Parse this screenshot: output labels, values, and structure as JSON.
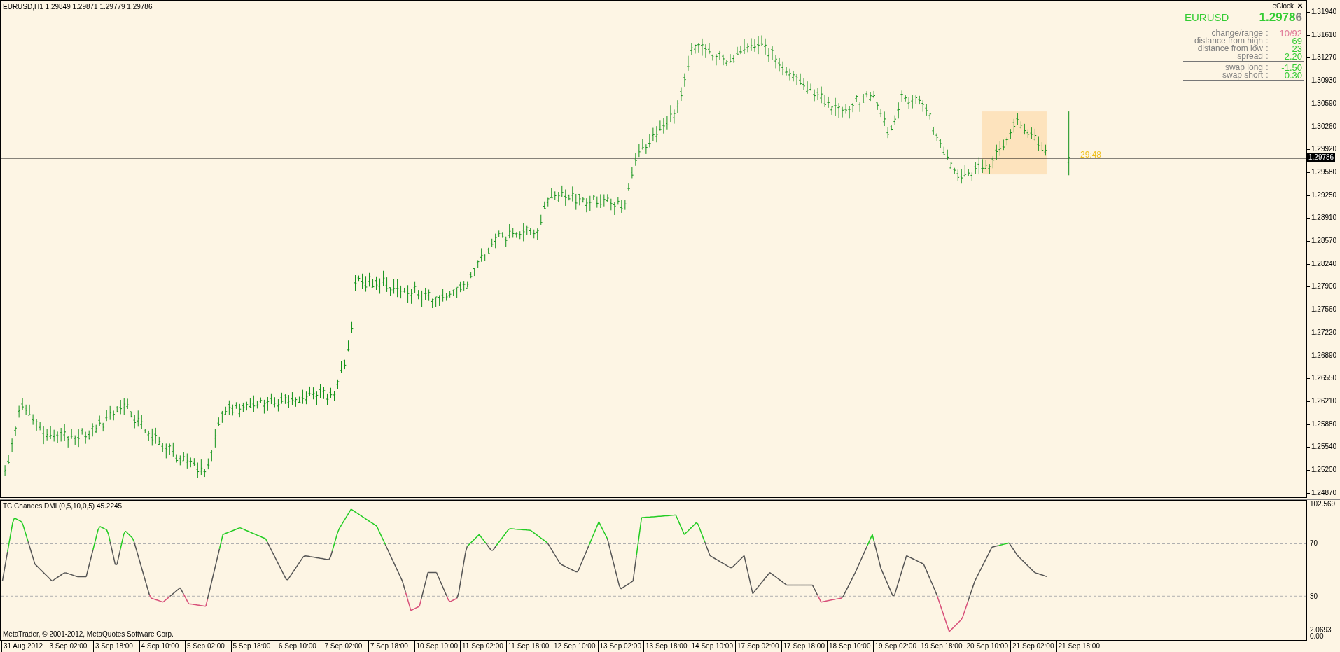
{
  "chart": {
    "title": "EURUSD,H1  1.29849 1.29871 1.29779 1.29786",
    "countdown": "29:48"
  },
  "eclock": {
    "title": "eClock",
    "symbol": "EURUSD",
    "price": "1.29786",
    "groups": [
      [
        {
          "label": "change/range",
          "separator": ":",
          "value": "10/92",
          "color": "#e07898"
        },
        {
          "label": "distance from high",
          "separator": ":",
          "value": "69",
          "color": "#33cc33"
        },
        {
          "label": "distance from low",
          "separator": ":",
          "value": "23",
          "color": "#33cc33"
        },
        {
          "label": "spread",
          "separator": ":",
          "value": "2.20",
          "color": "#33cc33"
        }
      ],
      [
        {
          "label": "swap long",
          "separator": ":",
          "value": "-1.50",
          "color": "#33cc33"
        },
        {
          "label": "swap short",
          "separator": ":",
          "value": "0.30",
          "color": "#33cc33"
        }
      ]
    ]
  },
  "price_axis": {
    "labels": [
      "1.31940",
      "1.31610",
      "1.31270",
      "1.30930",
      "1.30590",
      "1.30260",
      "1.29920",
      "1.29580",
      "1.29250",
      "1.28910",
      "1.28570",
      "1.28240",
      "1.27900",
      "1.27560",
      "1.27220",
      "1.26890",
      "1.26550",
      "1.26210",
      "1.25880",
      "1.25540",
      "1.25200",
      "1.24870"
    ],
    "current": "1.29786"
  },
  "indicator": {
    "title": "TC Chandes DMI (0,5,10,0,5) 45.2245",
    "copyright": "MetaTrader, © 2001-2012, MetaQuotes Software Corp.",
    "axis_labels": [
      "102.569",
      "70",
      "30",
      "2.0693",
      "0.00"
    ]
  },
  "time_axis": [
    "31 Aug 2012",
    "3 Sep 02:00",
    "3 Sep 18:00",
    "4 Sep 10:00",
    "5 Sep 02:00",
    "5 Sep 18:00",
    "6 Sep 10:00",
    "7 Sep 02:00",
    "7 Sep 18:00",
    "10 Sep 10:00",
    "11 Sep 02:00",
    "11 Sep 18:00",
    "12 Sep 10:00",
    "13 Sep 02:00",
    "13 Sep 18:00",
    "14 Sep 10:00",
    "17 Sep 02:00",
    "17 Sep 18:00",
    "18 Sep 10:00",
    "19 Sep 02:00",
    "19 Sep 18:00",
    "20 Sep 10:00",
    "21 Sep 02:00",
    "21 Sep 18:00"
  ]
}
